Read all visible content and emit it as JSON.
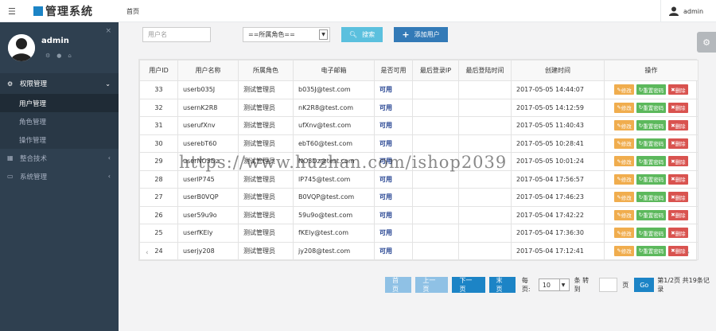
{
  "topbar": {
    "menu_icon": "menu-icon",
    "title": "管理系统",
    "breadcrumb": "首页",
    "user": "admin"
  },
  "sidebar": {
    "profile_name": "admin",
    "nav": [
      {
        "label": "权限管理",
        "icon": "cogs-icon",
        "open": true,
        "children": [
          "用户管理",
          "角色管理",
          "操作管理"
        ],
        "active_child": "用户管理"
      },
      {
        "label": "整合技术",
        "icon": "grid-icon"
      },
      {
        "label": "系统管理",
        "icon": "card-icon"
      }
    ]
  },
  "toolbar": {
    "username_placeholder": "用户名",
    "role_select": "==所属角色==",
    "search_label": "搜索",
    "add_label": "添加用户"
  },
  "table": {
    "headers": [
      "用户ID",
      "用户名称",
      "所属角色",
      "电子邮箱",
      "是否可用",
      "最后登录IP",
      "最后登陆时间",
      "创建时间",
      "操作"
    ],
    "rows": [
      [
        "33",
        "userb035J",
        "测试管理员",
        "b035J@test.com",
        "可用",
        "",
        "",
        "2017-05-05 14:44:07"
      ],
      [
        "32",
        "usernK2R8",
        "测试管理员",
        "nK2R8@test.com",
        "可用",
        "",
        "",
        "2017-05-05 14:12:59"
      ],
      [
        "31",
        "userufXnv",
        "测试管理员",
        "ufXnv@test.com",
        "可用",
        "",
        "",
        "2017-05-05 11:40:43"
      ],
      [
        "30",
        "userebT60",
        "测试管理员",
        "ebT60@test.com",
        "可用",
        "",
        "",
        "2017-05-05 10:28:41"
      ],
      [
        "29",
        "userNO3Dz",
        "测试管理员",
        "NO3Dz@test.com",
        "可用",
        "",
        "",
        "2017-05-05 10:01:24"
      ],
      [
        "28",
        "userlP745",
        "测试管理员",
        "lP745@test.com",
        "可用",
        "",
        "",
        "2017-05-04 17:56:57"
      ],
      [
        "27",
        "userB0VQP",
        "测试管理员",
        "B0VQP@test.com",
        "可用",
        "",
        "",
        "2017-05-04 17:46:23"
      ],
      [
        "26",
        "user59u9o",
        "测试管理员",
        "59u9o@test.com",
        "可用",
        "",
        "",
        "2017-05-04 17:42:22"
      ],
      [
        "25",
        "userfKEly",
        "测试管理员",
        "fKEly@test.com",
        "可用",
        "",
        "",
        "2017-05-04 17:36:30"
      ],
      [
        "24",
        "userjy208",
        "测试管理员",
        "jy208@test.com",
        "可用",
        "",
        "",
        "2017-05-04 17:12:41"
      ]
    ],
    "ops": {
      "edit": "修改",
      "reset": "重置密码",
      "delete": "删除"
    }
  },
  "watermark": "https://www.huzhan.com/ishop2039",
  "pager": {
    "first": "首页",
    "prev": "上一页",
    "next": "下一页",
    "last": "末页",
    "per_page_label": "每页:",
    "per_page_value": "10",
    "unit_label": "条 转到",
    "page_label": "页",
    "go": "Go",
    "summary": "第1/2页 共19条记录"
  },
  "colors": {
    "sidebar_bg": "#2f4050",
    "primary": "#1c84c6",
    "edit": "#f0ad4e",
    "reset": "#5cb85c",
    "delete": "#d9534f"
  }
}
